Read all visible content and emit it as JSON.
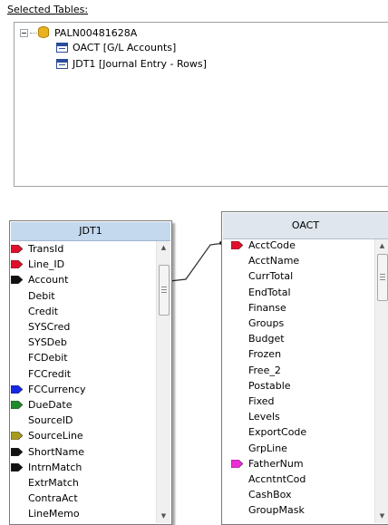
{
  "selected_tables": {
    "label": "Selected Tables:",
    "tree": {
      "root": "PALN00481628A",
      "children": [
        "OACT [G/L Accounts]",
        "JDT1 [Journal Entry - Rows]"
      ]
    }
  },
  "jdt1": {
    "title": "JDT1",
    "fields": [
      {
        "name": "TransId",
        "marker": "red"
      },
      {
        "name": "Line_ID",
        "marker": "red"
      },
      {
        "name": "Account",
        "marker": "black"
      },
      {
        "name": "Debit",
        "marker": ""
      },
      {
        "name": "Credit",
        "marker": ""
      },
      {
        "name": "SYSCred",
        "marker": ""
      },
      {
        "name": "SYSDeb",
        "marker": ""
      },
      {
        "name": "FCDebit",
        "marker": ""
      },
      {
        "name": "FCCredit",
        "marker": ""
      },
      {
        "name": "FCCurrency",
        "marker": "blue"
      },
      {
        "name": "DueDate",
        "marker": "green"
      },
      {
        "name": "SourceID",
        "marker": ""
      },
      {
        "name": "SourceLine",
        "marker": "olive"
      },
      {
        "name": "ShortName",
        "marker": "black"
      },
      {
        "name": "IntrnMatch",
        "marker": "black"
      },
      {
        "name": "ExtrMatch",
        "marker": ""
      },
      {
        "name": "ContraAct",
        "marker": ""
      },
      {
        "name": "LineMemo",
        "marker": ""
      }
    ]
  },
  "oact": {
    "title": "OACT",
    "fields": [
      {
        "name": "AcctCode",
        "marker": "red"
      },
      {
        "name": "AcctName",
        "marker": ""
      },
      {
        "name": "CurrTotal",
        "marker": ""
      },
      {
        "name": "EndTotal",
        "marker": ""
      },
      {
        "name": "Finanse",
        "marker": ""
      },
      {
        "name": "Groups",
        "marker": ""
      },
      {
        "name": "Budget",
        "marker": ""
      },
      {
        "name": "Frozen",
        "marker": ""
      },
      {
        "name": "Free_2",
        "marker": ""
      },
      {
        "name": "Postable",
        "marker": ""
      },
      {
        "name": "Fixed",
        "marker": ""
      },
      {
        "name": "Levels",
        "marker": ""
      },
      {
        "name": "ExportCode",
        "marker": ""
      },
      {
        "name": "GrpLine",
        "marker": ""
      },
      {
        "name": "FatherNum",
        "marker": "magenta"
      },
      {
        "name": "AccntntCod",
        "marker": ""
      },
      {
        "name": "CashBox",
        "marker": ""
      },
      {
        "name": "GroupMask",
        "marker": ""
      }
    ]
  },
  "marker_colors": {
    "red": "#e0102a",
    "black": "#111111",
    "blue": "#1428e6",
    "green": "#1f8a2a",
    "olive": "#a89b1c",
    "magenta": "#ee2cd8"
  },
  "icons": {
    "tree_expander": "minus-box-icon",
    "database": "database-icon",
    "table": "table-icon",
    "scroll_up": "arrow-up-icon",
    "scroll_down": "arrow-down-icon"
  }
}
